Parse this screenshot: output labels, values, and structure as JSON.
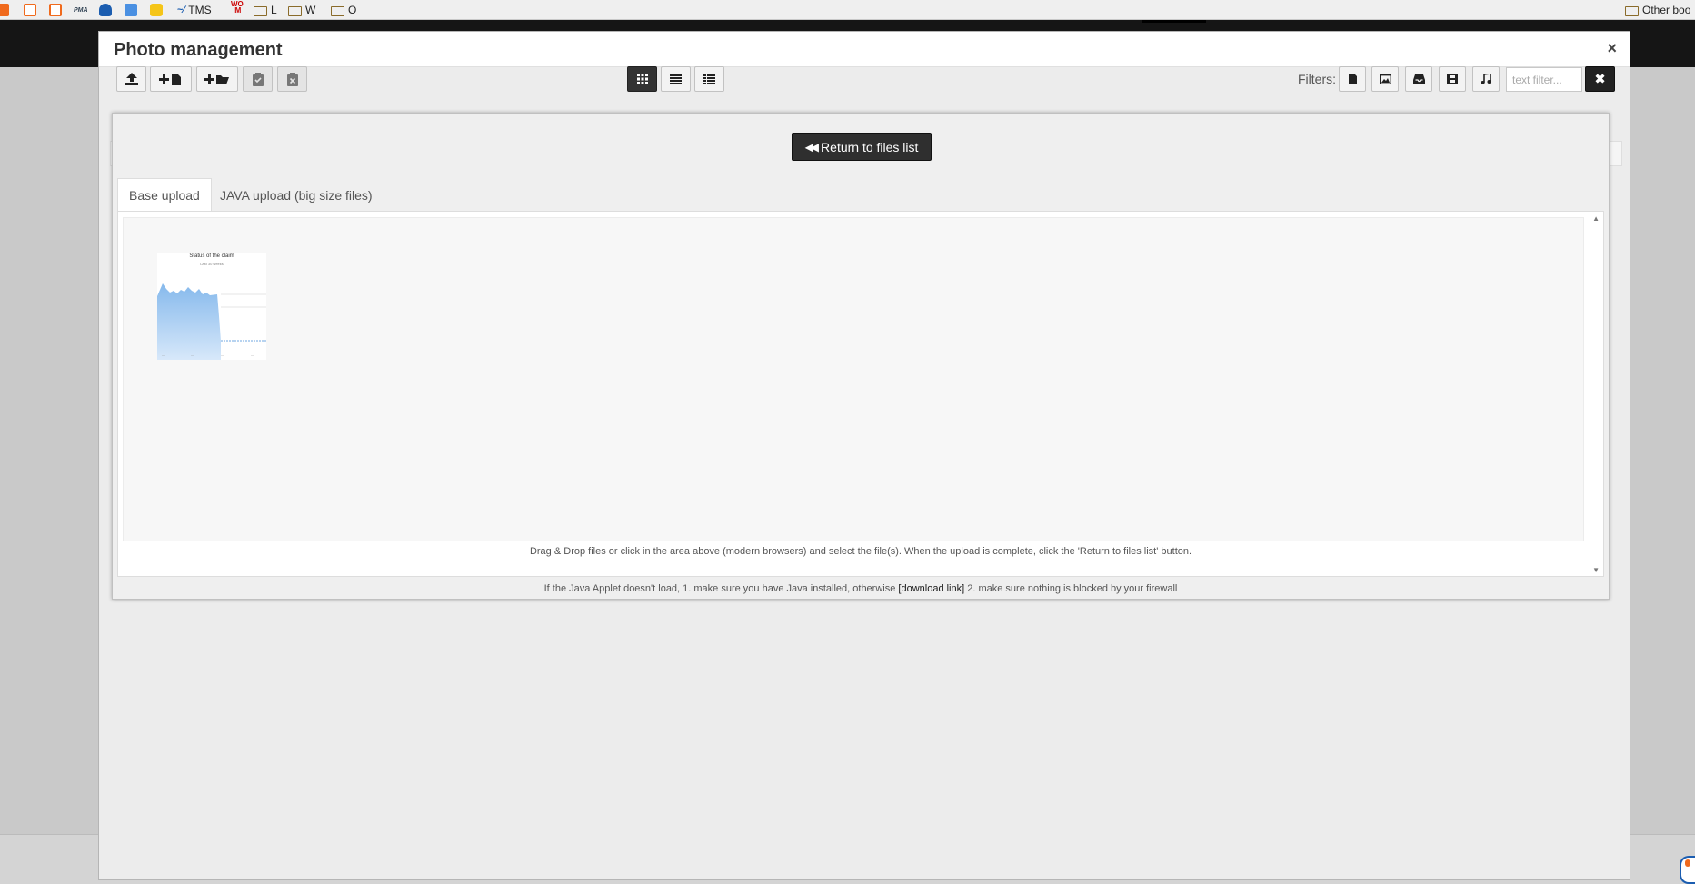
{
  "bookmarks": {
    "pma_label": "PMA",
    "tms_label": "TMS",
    "wo_label_1": "WO",
    "wo_label_2": "IM",
    "folder_l": "L",
    "folder_w": "W",
    "folder_o": "O",
    "other_bookmarks": "Other boo"
  },
  "modal": {
    "title": "Photo management",
    "close_glyph": "×"
  },
  "toolbar": {
    "filters_label": "Filters:",
    "text_filter_placeholder": "text filter...",
    "clear_glyph": "✖",
    "active_view": "grid"
  },
  "upload": {
    "return_arrows": "◀◀",
    "return_label": "Return to files list",
    "tabs": [
      {
        "label": "Base upload",
        "active": true
      },
      {
        "label": "JAVA upload (big size files)",
        "active": false
      }
    ],
    "thumbnail": {
      "title": "Status of the claim",
      "subtitle": "Last 30 weeks",
      "fill_color": "#a9cdf2"
    },
    "hint": "Drag & Drop files or click in the area above (modern browsers) and select the file(s). When the upload is complete, click the 'Return to files list' button.",
    "java_note_pre": "If the Java Applet doesn't load, 1. make sure you have Java installed, otherwise ",
    "java_note_link": "[download link]",
    "java_note_post": " 2. make sure nothing is blocked by your firewall"
  }
}
